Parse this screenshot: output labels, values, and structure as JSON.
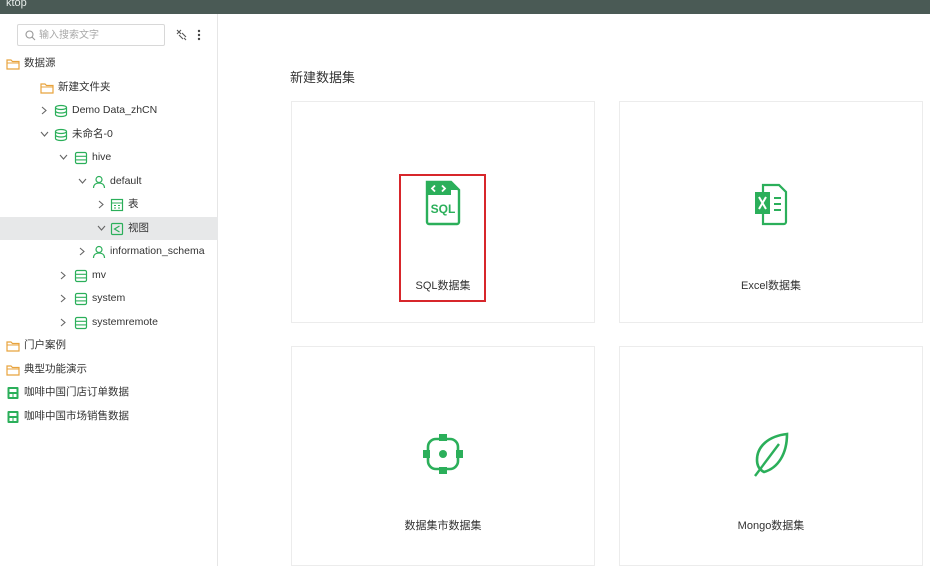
{
  "window": {
    "title": "ktop"
  },
  "search": {
    "placeholder": "输入搜索文字"
  },
  "toolbar": {
    "pin_icon": "pin-icon",
    "more_icon": "more-vertical-icon"
  },
  "tree": {
    "root": "数据源",
    "new_folder": "新建文件夹",
    "demo_data": "Demo Data_zhCN",
    "unnamed": "未命名-0",
    "hive": "hive",
    "default_schema": "default",
    "tables": "表",
    "views": "视图",
    "information_schema": "information_schema",
    "mv": "mv",
    "system": "system",
    "systemremote": "systemremote",
    "portal_case": "门户案例",
    "typical_demo": "典型功能演示",
    "coffee_store_orders": "咖啡中国门店订单数据",
    "coffee_market_sales": "咖啡中国市场销售数据"
  },
  "main": {
    "title": "新建数据集",
    "cards": [
      {
        "label": "SQL数据集",
        "icon": "sql-file-icon"
      },
      {
        "label": "Excel数据集",
        "icon": "excel-file-icon"
      },
      {
        "label": "数据集市数据集",
        "icon": "datamart-icon"
      },
      {
        "label": "Mongo数据集",
        "icon": "mongo-leaf-icon"
      }
    ]
  },
  "colors": {
    "brand_green": "#2baf5a",
    "highlight_red": "#d7262b",
    "folder_orange": "#e8a33d",
    "topbar": "#4a5a55",
    "selected_row": "#e7e8e9"
  }
}
